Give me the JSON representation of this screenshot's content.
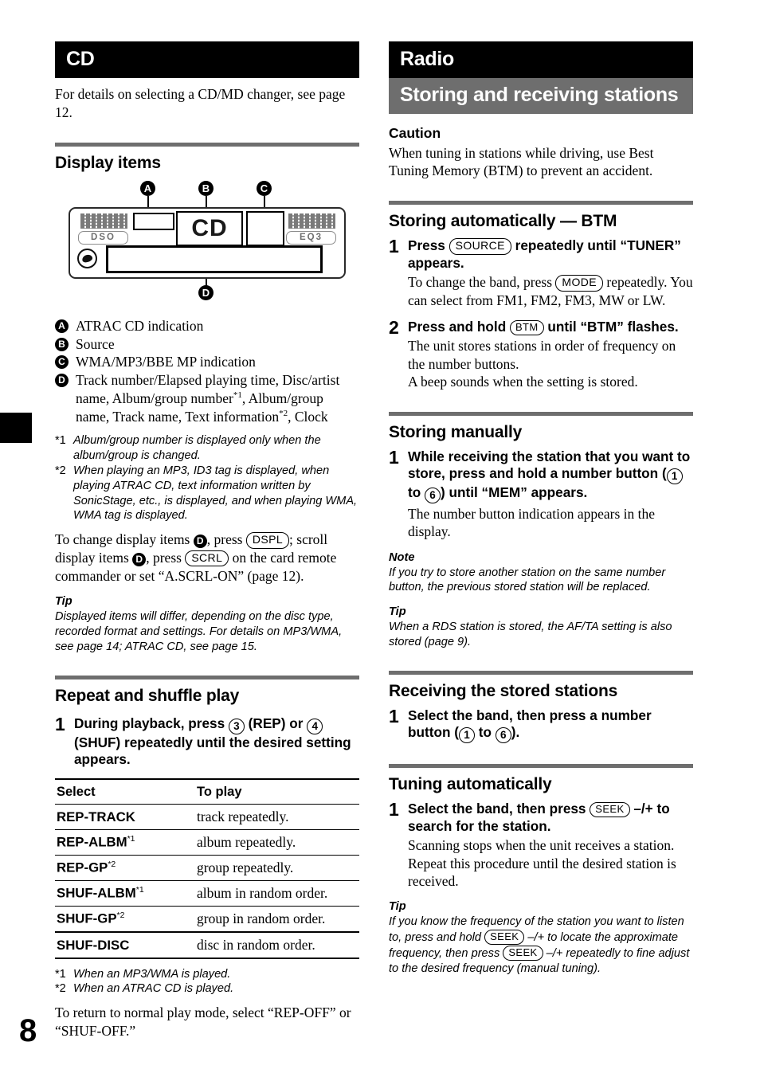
{
  "page": {
    "number": "8"
  },
  "left": {
    "chapter_banner": "CD",
    "intro": "For details on selecting a CD/MD changer, see page 12.",
    "display_items": {
      "heading": "Display items",
      "callouts": [
        "A",
        "B",
        "C",
        "D"
      ],
      "diagram": {
        "left_indicator": "DSO",
        "right_indicator": "EQ3",
        "segment_glyph": "CD",
        "disc_icon": "disc-icon"
      },
      "legend": [
        {
          "mark": "A",
          "text": "ATRAC CD indication"
        },
        {
          "mark": "B",
          "text": "Source"
        },
        {
          "mark": "C",
          "text": "WMA/MP3/BBE MP indication"
        },
        {
          "mark": "D",
          "text": "Track number/Elapsed playing time, Disc/artist name, Album/group number*1, Album/group name, Track name, Text information*2, Clock"
        }
      ],
      "footnotes": [
        {
          "mark": "*1",
          "text": "Album/group number is displayed only when the album/group is changed."
        },
        {
          "mark": "*2",
          "text": "When playing an MP3, ID3 tag is displayed, when playing ATRAC CD, text information written by SonicStage, etc., is displayed, and when playing WMA, WMA tag is displayed."
        }
      ],
      "change_text_1": "To change display items ",
      "change_text_2": ", press ",
      "dspl_button": "DSPL",
      "change_text_3": "; scroll display items ",
      "change_text_4": ", press ",
      "scrl_button": "SCRL",
      "change_text_5": " on the card remote commander or set “A.SCRL-ON” (page 12).",
      "tip_label": "Tip",
      "tip_text": "Displayed items will differ, depending on the disc type, recorded format and settings. For details on MP3/WMA, see page 14; ATRAC CD, see page 15."
    },
    "repeat_shuffle": {
      "heading": "Repeat and shuffle play",
      "step1": {
        "num": "1",
        "lead_a": "During playback, press ",
        "btn_rep": "3",
        "lead_b": " (REP) or ",
        "btn_shuf": "4",
        "lead_c": " (SHUF) repeatedly until the desired setting appears."
      },
      "table": {
        "headers": [
          "Select",
          "To play"
        ],
        "rows": [
          {
            "select": "REP-TRACK",
            "fn": "",
            "play": "track repeatedly."
          },
          {
            "select": "REP-ALBM",
            "fn": "*1",
            "play": "album repeatedly."
          },
          {
            "select": "REP-GP",
            "fn": "*2",
            "play": "group repeatedly."
          },
          {
            "select": "SHUF-ALBM",
            "fn": "*1",
            "play": "album in random order."
          },
          {
            "select": "SHUF-GP",
            "fn": "*2",
            "play": "group in random order."
          },
          {
            "select": "SHUF-DISC",
            "fn": "",
            "play": "disc in random order."
          }
        ]
      },
      "footnotes": [
        {
          "mark": "*1",
          "text": "When an MP3/WMA is played."
        },
        {
          "mark": "*2",
          "text": "When an ATRAC CD is played."
        }
      ],
      "closing": "To return to normal play mode, select “REP-OFF” or “SHUF-OFF.”"
    }
  },
  "right": {
    "chapter_banner": "Radio",
    "section_banner": "Storing and receiving stations",
    "caution": {
      "heading": "Caution",
      "text": "When tuning in stations while driving, use Best Tuning Memory (BTM) to prevent an accident."
    },
    "btm": {
      "heading": "Storing automatically — BTM",
      "step1": {
        "num": "1",
        "lead_a": "Press ",
        "btn_source": "SOURCE",
        "lead_b": " repeatedly until “TUNER” appears.",
        "detail_a": "To change the band, press ",
        "btn_mode": "MODE",
        "detail_b": " repeatedly. You can select from FM1, FM2, FM3, MW or LW."
      },
      "step2": {
        "num": "2",
        "lead_a": "Press and hold ",
        "btn_btm": "BTM",
        "lead_b": " until “BTM” flashes.",
        "detail": "The unit stores stations in order of frequency on the number buttons.\nA beep sounds when the setting is stored."
      }
    },
    "manual": {
      "heading": "Storing manually",
      "step1": {
        "num": "1",
        "lead_a": "While receiving the station that you want to store, press and hold a number button (",
        "btn_1": "1",
        "lead_b": " to ",
        "btn_6": "6",
        "lead_c": ") until “MEM” appears.",
        "detail": "The number button indication appears in the display."
      },
      "note_label": "Note",
      "note_text": "If you try to store another station on the same number button, the previous stored station will be replaced.",
      "tip_label": "Tip",
      "tip_text": "When a RDS station is stored, the AF/TA setting is also stored (page 9)."
    },
    "receiving": {
      "heading": "Receiving the stored stations",
      "step1": {
        "num": "1",
        "lead_a": "Select the band, then press a number button (",
        "btn_1": "1",
        "lead_b": " to ",
        "btn_6": "6",
        "lead_c": ")."
      }
    },
    "tuning": {
      "heading": "Tuning automatically",
      "step1": {
        "num": "1",
        "lead_a": "Select the band, then press ",
        "btn_seek": "SEEK",
        "lead_b": " –/+ to search for the station.",
        "detail": "Scanning stops when the unit receives a station. Repeat this procedure until the desired station is received."
      },
      "tip_label": "Tip",
      "tip_a": "If you know the frequency of the station you want to listen to, press and hold ",
      "tip_seek_1": "SEEK",
      "tip_b": " –/+ to locate the approximate frequency, then press ",
      "tip_seek_2": "SEEK",
      "tip_c": " –/+ repeatedly to fine adjust to the desired frequency (manual tuning)."
    }
  }
}
